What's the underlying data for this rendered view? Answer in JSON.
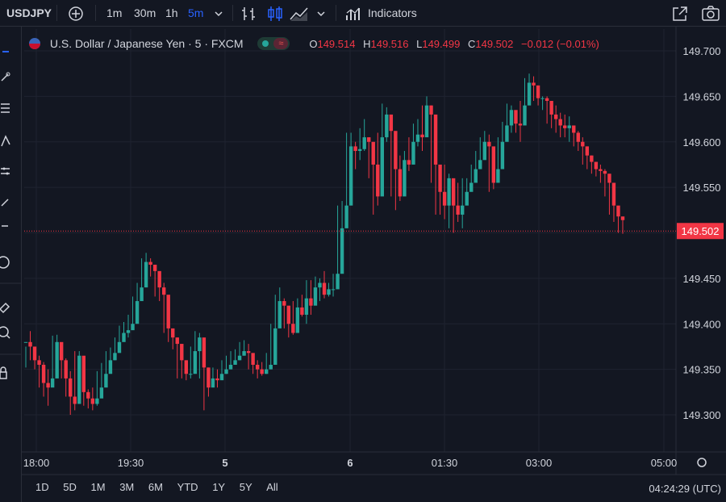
{
  "toolbar": {
    "symbol": "USDJPY",
    "intervals": [
      "1m",
      "30m",
      "1h",
      "5m"
    ],
    "active_interval": "5m",
    "indicators_label": "Indicators"
  },
  "legend": {
    "instrument": "U.S. Dollar / Japanese Yen · 5 · FXCM",
    "badge": "≈",
    "open_key": "O",
    "open": "149.514",
    "high_key": "H",
    "high": "149.516",
    "low_key": "L",
    "low": "149.499",
    "close_key": "C",
    "close": "149.502",
    "change": "−0.012 (−0.01%)"
  },
  "bottom": {
    "ranges": [
      "1D",
      "5D",
      "1M",
      "3M",
      "6M",
      "YTD",
      "1Y",
      "5Y",
      "All"
    ],
    "clock": "04:24:29 (UTC)"
  },
  "colors": {
    "up": "#26a69a",
    "down": "#f23645",
    "bg": "#131722",
    "grid": "#1f2330",
    "accent": "#2962ff"
  },
  "chart_data": {
    "type": "candlestick",
    "y_ticks": [
      "149.700",
      "149.650",
      "149.600",
      "149.550",
      "149.450",
      "149.400",
      "149.350",
      "149.300"
    ],
    "ylim": [
      149.27,
      149.72
    ],
    "x_ticks": [
      "18:00",
      "19:30",
      "5",
      "6",
      "01:30",
      "03:00",
      "05:00"
    ],
    "last_price": "149.502",
    "candles": [
      [
        149.38,
        149.375,
        149.352
      ],
      [
        149.375,
        149.392,
        149.36
      ],
      [
        149.36,
        149.37,
        149.35
      ],
      [
        149.355,
        149.365,
        149.33
      ],
      [
        149.335,
        149.358,
        149.32
      ],
      [
        149.33,
        149.35,
        149.31
      ],
      [
        149.34,
        149.387,
        149.332
      ],
      [
        149.38,
        149.388,
        149.355
      ],
      [
        149.36,
        149.368,
        149.34
      ],
      [
        149.34,
        149.362,
        149.32
      ],
      [
        149.32,
        149.348,
        149.3
      ],
      [
        149.312,
        149.37,
        149.305
      ],
      [
        149.365,
        149.37,
        149.32
      ],
      [
        149.325,
        149.34,
        149.31
      ],
      [
        149.318,
        149.328,
        149.307
      ],
      [
        149.312,
        149.33,
        149.305
      ],
      [
        149.318,
        149.348,
        149.31
      ],
      [
        149.33,
        149.357,
        149.325
      ],
      [
        149.345,
        149.37,
        149.34
      ],
      [
        149.36,
        149.374,
        149.355
      ],
      [
        149.368,
        149.385,
        149.36
      ],
      [
        149.38,
        149.398,
        149.375
      ],
      [
        149.39,
        149.402,
        149.384
      ],
      [
        149.393,
        149.41,
        149.385
      ],
      [
        149.4,
        149.43,
        149.397
      ],
      [
        149.425,
        149.445,
        149.418
      ],
      [
        149.44,
        149.472,
        149.435
      ],
      [
        149.468,
        149.478,
        149.458
      ],
      [
        149.465,
        149.472,
        149.452
      ],
      [
        149.458,
        149.46,
        149.43
      ],
      [
        149.44,
        149.448,
        149.425
      ],
      [
        149.432,
        149.445,
        149.39
      ],
      [
        149.395,
        149.4,
        149.38
      ],
      [
        149.385,
        149.392,
        149.372
      ],
      [
        149.378,
        149.385,
        149.34
      ],
      [
        149.36,
        149.362,
        149.34
      ],
      [
        149.345,
        149.36,
        149.338
      ],
      [
        149.345,
        149.375,
        149.34
      ],
      [
        149.37,
        149.392,
        149.365
      ],
      [
        149.385,
        149.39,
        149.34
      ],
      [
        149.352,
        149.355,
        149.305
      ],
      [
        149.33,
        149.352,
        149.32
      ],
      [
        149.34,
        149.352,
        149.332
      ],
      [
        149.338,
        149.35,
        149.33
      ],
      [
        149.345,
        149.36,
        149.34
      ],
      [
        149.35,
        149.365,
        149.345
      ],
      [
        149.355,
        149.37,
        149.35
      ],
      [
        149.36,
        149.372,
        149.355
      ],
      [
        149.365,
        149.38,
        149.36
      ],
      [
        149.37,
        149.382,
        149.365
      ],
      [
        149.368,
        149.378,
        149.35
      ],
      [
        149.355,
        149.365,
        149.345
      ],
      [
        149.35,
        149.36,
        149.34
      ],
      [
        149.345,
        149.358,
        149.343
      ],
      [
        149.35,
        149.368,
        149.345
      ],
      [
        149.355,
        149.4,
        149.35
      ],
      [
        149.395,
        149.432,
        149.39
      ],
      [
        149.425,
        149.44,
        149.41
      ],
      [
        149.42,
        149.428,
        149.395
      ],
      [
        149.4,
        149.412,
        149.385
      ],
      [
        149.39,
        149.425,
        149.388
      ],
      [
        149.418,
        149.428,
        149.405
      ],
      [
        149.41,
        149.432,
        149.408
      ],
      [
        149.428,
        149.448,
        149.4
      ],
      [
        149.42,
        149.448,
        149.41
      ],
      [
        149.44,
        149.452,
        149.436
      ],
      [
        149.445,
        149.45,
        149.425
      ],
      [
        149.432,
        149.458,
        149.428
      ],
      [
        149.438,
        149.445,
        149.43
      ],
      [
        149.438,
        149.455,
        149.43
      ],
      [
        149.455,
        149.53,
        149.45
      ],
      [
        149.505,
        149.535,
        149.47
      ],
      [
        149.53,
        149.61,
        149.52
      ],
      [
        149.595,
        149.61,
        149.575
      ],
      [
        149.59,
        149.6,
        149.57
      ],
      [
        149.592,
        149.615,
        149.58
      ],
      [
        149.605,
        149.625,
        149.59
      ],
      [
        149.6,
        149.605,
        149.56
      ],
      [
        149.575,
        149.59,
        149.52
      ],
      [
        149.54,
        149.61,
        149.53
      ],
      [
        149.605,
        149.642,
        149.595
      ],
      [
        149.63,
        149.638,
        149.6
      ],
      [
        149.612,
        149.62,
        149.54
      ],
      [
        149.57,
        149.6,
        149.525
      ],
      [
        149.54,
        149.585,
        149.535
      ],
      [
        149.58,
        149.59,
        149.56
      ],
      [
        149.575,
        149.605,
        149.568
      ],
      [
        149.6,
        149.62,
        149.58
      ],
      [
        149.608,
        149.625,
        149.595
      ],
      [
        149.605,
        149.64,
        149.59
      ],
      [
        149.64,
        149.65,
        149.62
      ],
      [
        149.63,
        149.64,
        149.555
      ],
      [
        149.575,
        149.585,
        149.52
      ],
      [
        149.545,
        149.56,
        149.52
      ],
      [
        149.53,
        149.575,
        149.515
      ],
      [
        149.56,
        149.565,
        149.505
      ],
      [
        149.53,
        149.55,
        149.5
      ],
      [
        149.52,
        149.555,
        149.512
      ],
      [
        149.53,
        149.56,
        149.505
      ],
      [
        149.545,
        149.56,
        149.54
      ],
      [
        149.555,
        149.575,
        149.548
      ],
      [
        149.57,
        149.59,
        149.56
      ],
      [
        149.58,
        149.605,
        149.57
      ],
      [
        149.6,
        149.612,
        149.585
      ],
      [
        149.595,
        149.608,
        149.545
      ],
      [
        149.555,
        149.575,
        149.548
      ],
      [
        149.57,
        149.605,
        149.565
      ],
      [
        149.6,
        149.622,
        149.59
      ],
      [
        149.618,
        149.642,
        149.61
      ],
      [
        149.635,
        149.64,
        149.61
      ],
      [
        149.62,
        149.628,
        149.61
      ],
      [
        149.618,
        149.645,
        149.6
      ],
      [
        149.64,
        149.67,
        149.635
      ],
      [
        149.665,
        149.675,
        149.65
      ],
      [
        149.662,
        149.672,
        149.645
      ],
      [
        149.648,
        149.655,
        149.64
      ],
      [
        149.648,
        149.65,
        149.635
      ],
      [
        149.645,
        149.65,
        149.62
      ],
      [
        149.63,
        149.642,
        149.615
      ],
      [
        149.625,
        149.64,
        149.61
      ],
      [
        149.618,
        149.632,
        149.605
      ],
      [
        149.615,
        149.63,
        149.605
      ],
      [
        149.618,
        149.628,
        149.6
      ],
      [
        149.61,
        149.615,
        149.595
      ],
      [
        149.6,
        149.612,
        149.59
      ],
      [
        149.595,
        149.605,
        149.575
      ],
      [
        149.585,
        149.595,
        149.57
      ],
      [
        149.578,
        149.585,
        149.565
      ],
      [
        149.57,
        149.578,
        149.562
      ],
      [
        149.568,
        149.575,
        149.555
      ],
      [
        149.565,
        149.57,
        149.54
      ],
      [
        149.555,
        149.56,
        149.52
      ],
      [
        149.53,
        149.54,
        149.512
      ],
      [
        149.518,
        149.525,
        149.5
      ],
      [
        149.514,
        149.516,
        149.499
      ]
    ]
  }
}
